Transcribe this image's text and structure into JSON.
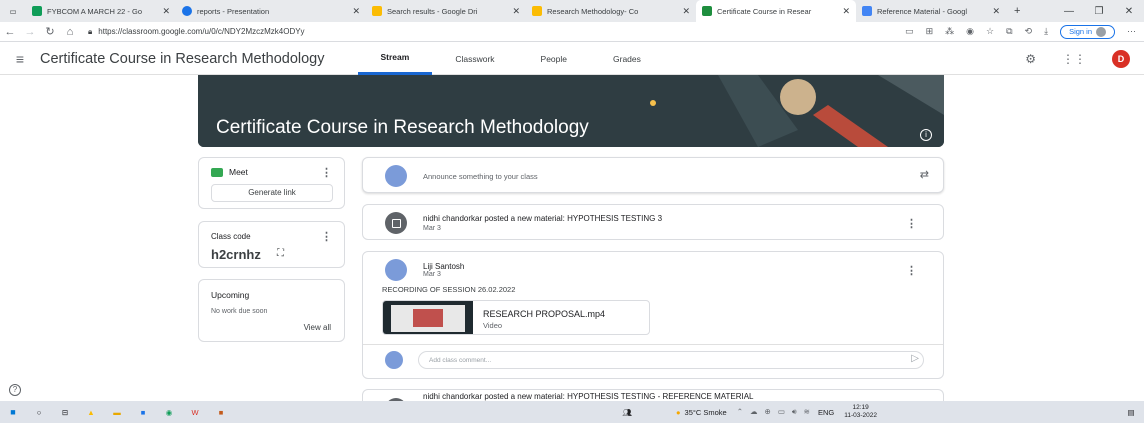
{
  "browser": {
    "tabs": [
      {
        "label": "FYBCOM A MARCH 22 - Go",
        "color": "#0f9d58"
      },
      {
        "label": "reports - Presentation",
        "color": "#1a73e8"
      },
      {
        "label": "Search results - Google Dri",
        "color": "#fbbc04"
      },
      {
        "label": "Research Methodology- Co",
        "color": "#fbbc04"
      },
      {
        "label": "Certificate Course in Resear",
        "color": "#1e8e3e"
      },
      {
        "label": "Reference Material - Googl",
        "color": "#4285f4"
      }
    ],
    "new_tab": "+",
    "url": "https://classroom.google.com/u/0/c/NDY2MzczMzk4ODYy",
    "signin": "Sign in"
  },
  "classroom": {
    "course_title": "Certificate Course in Research Methodology",
    "tabs": [
      "Stream",
      "Classwork",
      "People",
      "Grades"
    ],
    "active_tab": "Stream",
    "user_initial": "D",
    "banner_title": "Certificate Course in Research Methodology",
    "meet": {
      "label": "Meet",
      "button": "Generate link"
    },
    "class_code": {
      "label": "Class code",
      "code": "h2crnhz"
    },
    "upcoming": {
      "title": "Upcoming",
      "empty": "No work due soon",
      "view_all": "View all"
    },
    "announce_placeholder": "Announce something to your class",
    "posts": [
      {
        "text": "nidhi chandorkar posted a new material: HYPOTHESIS TESTING 3",
        "date": "Mar 3"
      },
      {
        "author": "Liji Santosh",
        "date": "Mar 3",
        "body": "RECORDING OF SESSION 26.02.2022",
        "attachment_title": "RESEARCH PROPOSAL.mp4",
        "attachment_type": "Video",
        "comment_placeholder": "Add class comment..."
      },
      {
        "text": "nidhi chandorkar posted a new material: HYPOTHESIS TESTING - REFERENCE MATERIAL"
      }
    ]
  },
  "taskbar": {
    "weather": "35°C Smoke",
    "lang": "ENG",
    "time": "12:19",
    "date": "11-03-2022"
  },
  "colors": {
    "accent": "#1967d2",
    "banner": "#2d3a3f",
    "avatar": "#d93025",
    "post_avatar": "#7b9bd9"
  }
}
